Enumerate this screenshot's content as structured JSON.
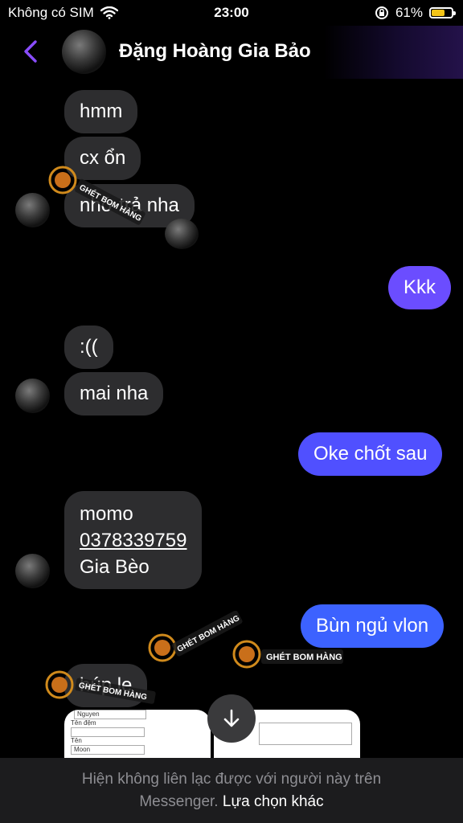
{
  "status_bar": {
    "carrier": "Không có SIM",
    "time": "23:00",
    "battery_percent": "61%",
    "battery_level": 0.61
  },
  "header": {
    "contact_name": "Đặng Hoàng Gia Bảo"
  },
  "messages": [
    {
      "side": "in",
      "text": "hmm"
    },
    {
      "side": "in",
      "text": "cx ổn"
    },
    {
      "side": "in",
      "text": "nhớ trả nha"
    },
    {
      "side": "out",
      "text": "Kkk"
    },
    {
      "side": "in",
      "text": ":(("
    },
    {
      "side": "in",
      "text": "mai nha"
    },
    {
      "side": "out",
      "text": "Oke chốt sau"
    },
    {
      "side": "in",
      "lines": [
        "momo",
        "0378339759",
        "Gia Bèo"
      ]
    },
    {
      "side": "out",
      "text": "Bùn ngủ vlon"
    },
    {
      "side": "in",
      "text": "húp le"
    }
  ],
  "form_preview": {
    "fields": [
      {
        "label": "",
        "value": "Nguyen"
      },
      {
        "label": "Tên đệm",
        "value": ""
      },
      {
        "label": "Tên",
        "value": "Moon"
      }
    ]
  },
  "watermark": "GHÉT BOM HÀNG",
  "footer": {
    "notice": "Hiện không liên lạc được với người này trên",
    "notice_line2": "Messenger.",
    "action": "Lựa chọn khác"
  },
  "colors": {
    "background": "#000000",
    "incoming_bubble": "#2d2d2f",
    "outgoing_top": "#7a4dff",
    "outgoing_bottom": "#2f6bff",
    "accent": "#8a4dff",
    "footer": "#1c1c1e"
  },
  "icons": [
    "wifi-icon",
    "rotation-lock-icon",
    "battery-icon",
    "back-chevron-icon",
    "arrow-down-icon"
  ]
}
